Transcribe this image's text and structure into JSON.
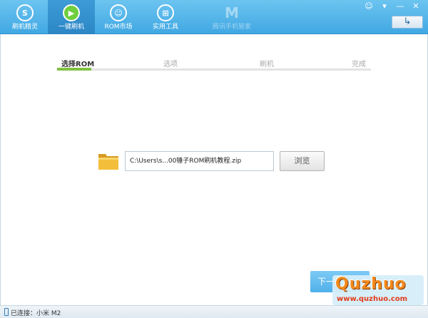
{
  "toolbar": {
    "items": [
      {
        "label": "刷机精灵",
        "icon": "s-logo-icon"
      },
      {
        "label": "一键刷机",
        "icon": "play-icon"
      },
      {
        "label": "ROM市场",
        "icon": "android-icon"
      },
      {
        "label": "实用工具",
        "icon": "grid-icon"
      },
      {
        "label": "腾讯手机管家",
        "icon": "shield-m-icon"
      }
    ],
    "active_index": 1
  },
  "window_controls": {
    "feedback": "☺",
    "menu": "▾",
    "minimize": "—",
    "close": "✕",
    "back": "↳"
  },
  "steps": {
    "items": [
      "选择ROM",
      "选项",
      "刷机",
      "完成"
    ],
    "active_index": 0
  },
  "file_picker": {
    "path": "C:\\Users\\s...00锤子ROM刷机教程.zip",
    "browse_label": "浏览"
  },
  "next_button": {
    "label": "下一"
  },
  "watermark": {
    "big": "Quzhuo",
    "small": "www.quzhuo.com"
  },
  "status": {
    "connection": "已连接：小米 M2"
  },
  "colors": {
    "toolbar": "#41a8e3",
    "accent_green": "#7fc241",
    "next_blue": "#4fb0ea",
    "watermark_orange": "#f38a1c"
  }
}
